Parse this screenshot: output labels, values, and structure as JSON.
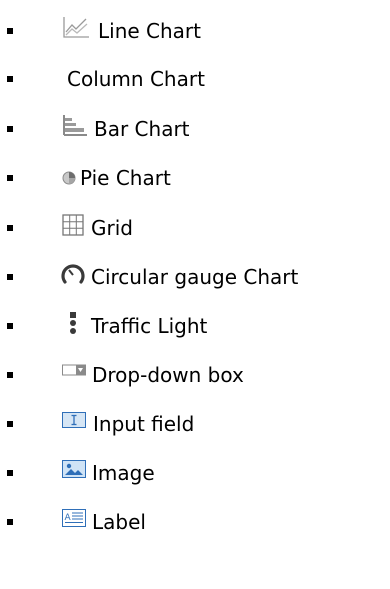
{
  "items": [
    {
      "label": "Line Chart",
      "icon": "line-chart-icon"
    },
    {
      "label": "Column Chart",
      "icon": ""
    },
    {
      "label": "Bar Chart",
      "icon": "bar-chart-icon"
    },
    {
      "label": "Pie Chart",
      "icon": "pie-chart-icon"
    },
    {
      "label": "Grid",
      "icon": "grid-icon"
    },
    {
      "label": "Circular gauge Chart",
      "icon": "gauge-icon"
    },
    {
      "label": "Traffic Light",
      "icon": "traffic-light-icon"
    },
    {
      "label": "Drop-down box",
      "icon": "dropdown-box-icon"
    },
    {
      "label": "Input field",
      "icon": "input-field-icon"
    },
    {
      "label": "Image",
      "icon": "image-icon"
    },
    {
      "label": "Label",
      "icon": "label-icon"
    }
  ],
  "colors": {
    "icon_gray": "#8a8a8a",
    "icon_blue": "#2f6fb8",
    "bullet": "#000000"
  }
}
